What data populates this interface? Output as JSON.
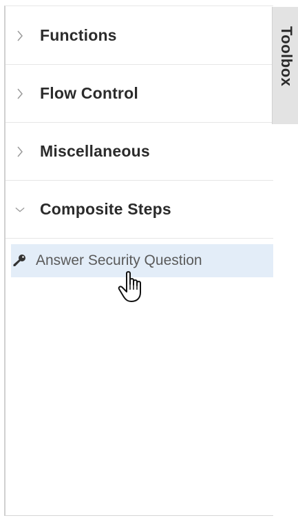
{
  "toolbox": {
    "tab_label": "Toolbox",
    "sections": [
      {
        "label": "Functions",
        "expanded": false,
        "icon": "chevron-right-icon"
      },
      {
        "label": "Flow Control",
        "expanded": false,
        "icon": "chevron-right-icon"
      },
      {
        "label": "Miscellaneous",
        "expanded": false,
        "icon": "chevron-right-icon"
      },
      {
        "label": "Composite Steps",
        "expanded": true,
        "icon": "chevron-down-icon"
      }
    ],
    "composite_items": [
      {
        "label": "Answer Security Question",
        "icon": "key-icon",
        "hovered": true
      }
    ]
  },
  "colors": {
    "hover_background": "#e3edf8",
    "tab_background": "#e3e3e3",
    "header_text": "#2b2b2b",
    "item_text": "#5a5a5a"
  }
}
